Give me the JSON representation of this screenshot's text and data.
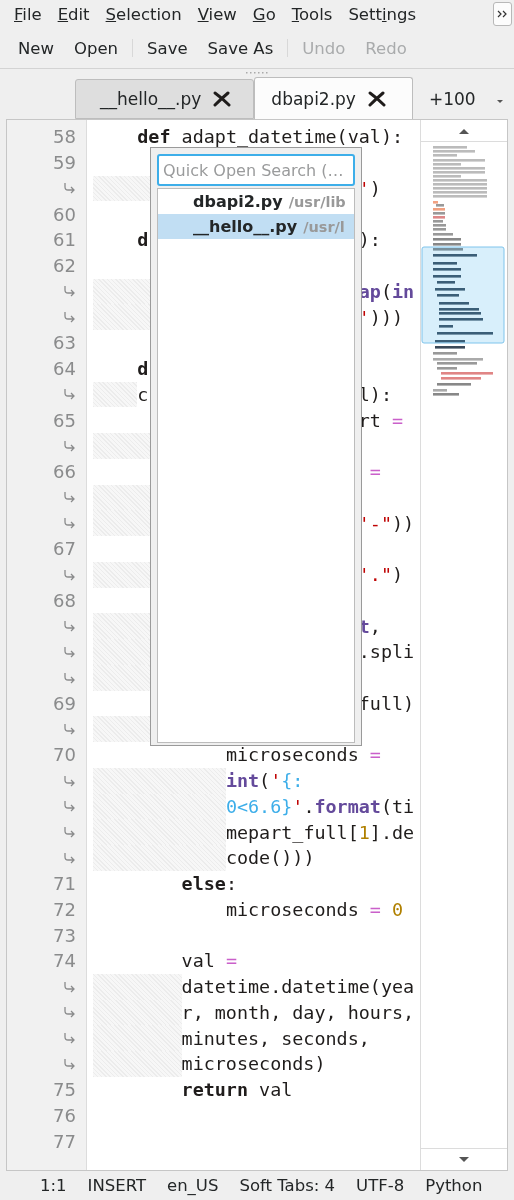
{
  "menu": [
    {
      "key": "F",
      "rest": "ile"
    },
    {
      "key": "E",
      "rest": "dit"
    },
    {
      "key": "S",
      "rest": "election"
    },
    {
      "key": "V",
      "rest": "iew"
    },
    {
      "key": "G",
      "rest": "o"
    },
    {
      "key": "T",
      "rest": "ools"
    },
    {
      "lead": "Sett",
      "key": "i",
      "rest": "ngs"
    }
  ],
  "toolbar": [
    [
      {
        "label": "New",
        "disabled": false
      },
      {
        "label": "Open",
        "disabled": false
      }
    ],
    [
      {
        "label": "Save",
        "disabled": false
      },
      {
        "label": "Save As",
        "disabled": false
      }
    ],
    [
      {
        "label": "Undo",
        "disabled": true
      },
      {
        "label": "Redo",
        "disabled": true
      }
    ]
  ],
  "tabs": [
    {
      "label": "__hello__.py",
      "selected": false
    },
    {
      "label": "dbapi2.py",
      "selected": true
    }
  ],
  "more_tabs": "+100",
  "rows": [
    {
      "number": "58",
      "wrap": false,
      "fragments": [
        [
          {
            "text": "    def",
            "kind": "keyword"
          },
          {
            "text": " adapt_datetime(val):",
            "kind": "plain"
          }
        ]
      ]
    },
    {
      "number": "59",
      "wrap": false
    },
    {
      "wrap": true,
      "fragments": [
        [
          {
            "text": "                        '",
            "kind": "string"
          },
          {
            "text": ")",
            "kind": "plain"
          }
        ]
      ]
    },
    {
      "number": "60",
      "wrap": false
    },
    {
      "number": "61",
      "wrap": false,
      "fragments": [
        [
          {
            "text": "    d",
            "kind": "keyword"
          }
        ],
        [
          {
            "text": "                   ):",
            "kind": "plain"
          }
        ]
      ]
    },
    {
      "number": "62",
      "wrap": false
    },
    {
      "wrap": true,
      "fragments": [
        [
          {
            "text": "                        ap",
            "kind": "builtin"
          },
          {
            "text": "(",
            "kind": "plain"
          },
          {
            "text": "in",
            "kind": "builtin"
          }
        ]
      ]
    },
    {
      "wrap": true,
      "fragments": [
        [
          {
            "text": "                        '",
            "kind": "string"
          },
          {
            "text": ")))",
            "kind": "plain"
          }
        ]
      ]
    },
    {
      "number": "63",
      "wrap": false
    },
    {
      "number": "64",
      "wrap": false,
      "fragments": [
        [
          {
            "text": "    d",
            "kind": "keyword"
          }
        ]
      ]
    },
    {
      "wrap": true,
      "fragments": [
        [
          {
            "text": "    c",
            "kind": "plain"
          }
        ],
        [
          {
            "text": "                   l):",
            "kind": "plain"
          }
        ]
      ]
    },
    {
      "number": "65",
      "wrap": false,
      "fragments": [
        [
          {
            "text": "                        rt ",
            "kind": "plain"
          },
          {
            "text": "=",
            "kind": "operator"
          }
        ]
      ]
    },
    {
      "wrap": true
    },
    {
      "number": "66",
      "wrap": false,
      "fragments": [
        [
          {
            "text": "                         =",
            "kind": "operator"
          }
        ]
      ]
    },
    {
      "wrap": true
    },
    {
      "wrap": true,
      "fragments": [
        [
          {
            "text": "                        '-\"",
            "kind": "string"
          },
          {
            "text": "))",
            "kind": "plain"
          }
        ]
      ]
    },
    {
      "number": "67",
      "wrap": false
    },
    {
      "wrap": true,
      "fragments": [
        [
          {
            "text": "                        '.\"",
            "kind": "string"
          },
          {
            "text": ")",
            "kind": "plain"
          }
        ]
      ]
    },
    {
      "number": "68",
      "wrap": false
    },
    {
      "wrap": true,
      "fragments": [
        [
          {
            "text": "                        t",
            "kind": "builtin"
          },
          {
            "text": ",",
            "kind": "plain"
          }
        ]
      ]
    },
    {
      "wrap": true,
      "fragments": [
        [
          {
            "text": "                        .spli",
            "kind": "plain"
          }
        ]
      ]
    },
    {
      "wrap": true
    },
    {
      "number": "69",
      "wrap": false,
      "fragments": [
        [
          {
            "text": "                        full)",
            "kind": "plain"
          }
        ]
      ]
    },
    {
      "wrap": true
    },
    {
      "number": "70",
      "wrap": false,
      "fragments": [
        [
          {
            "text": "            microseconds ",
            "kind": "plain"
          },
          {
            "text": "=",
            "kind": "operator"
          }
        ]
      ]
    },
    {
      "wrap": true,
      "fragments": [
        [
          {
            "text": "            int",
            "kind": "builtin"
          },
          {
            "text": "(",
            "kind": "plain"
          },
          {
            "text": "'",
            "kind": "string"
          },
          {
            "text": "{:",
            "kind": "format"
          }
        ]
      ]
    },
    {
      "wrap": true,
      "fragments": [
        [
          {
            "text": "            0<6.6}",
            "kind": "format"
          },
          {
            "text": "'",
            "kind": "string"
          },
          {
            "text": ".",
            "kind": "plain"
          },
          {
            "text": "format",
            "kind": "builtin"
          },
          {
            "text": "(ti",
            "kind": "plain"
          }
        ]
      ]
    },
    {
      "wrap": true,
      "fragments": [
        [
          {
            "text": "            mepart_full[",
            "kind": "plain"
          },
          {
            "text": "1",
            "kind": "number"
          },
          {
            "text": "].de",
            "kind": "plain"
          }
        ]
      ]
    },
    {
      "wrap": true,
      "fragments": [
        [
          {
            "text": "            code()))",
            "kind": "plain"
          }
        ]
      ]
    },
    {
      "number": "71",
      "wrap": false,
      "fragments": [
        [
          {
            "text": "        else",
            "kind": "keyword"
          },
          {
            "text": ":",
            "kind": "plain"
          }
        ]
      ]
    },
    {
      "number": "72",
      "wrap": false,
      "fragments": [
        [
          {
            "text": "            microseconds ",
            "kind": "plain"
          },
          {
            "text": "=",
            "kind": "operator"
          },
          {
            "text": " 0",
            "kind": "number"
          }
        ]
      ]
    },
    {
      "number": "73",
      "wrap": false
    },
    {
      "number": "74",
      "wrap": false,
      "fragments": [
        [
          {
            "text": "        val ",
            "kind": "plain"
          },
          {
            "text": "=",
            "kind": "operator"
          }
        ]
      ]
    },
    {
      "wrap": true,
      "fragments": [
        [
          {
            "text": "        datetime.datetime(yea",
            "kind": "plain"
          }
        ]
      ]
    },
    {
      "wrap": true,
      "fragments": [
        [
          {
            "text": "        r, month, day, hours,",
            "kind": "plain"
          }
        ]
      ]
    },
    {
      "wrap": true,
      "fragments": [
        [
          {
            "text": "        minutes, seconds,",
            "kind": "plain"
          }
        ]
      ]
    },
    {
      "wrap": true,
      "fragments": [
        [
          {
            "text": "        microseconds)",
            "kind": "plain"
          }
        ]
      ]
    },
    {
      "number": "75",
      "wrap": false,
      "fragments": [
        [
          {
            "text": "        return",
            "kind": "keyword"
          },
          {
            "text": " val",
            "kind": "plain"
          }
        ]
      ]
    },
    {
      "number": "76",
      "wrap": false
    },
    {
      "number": "77",
      "wrap": false
    }
  ],
  "quick_open": {
    "placeholder": "Quick Open Search (…",
    "results": [
      {
        "name": "dbapi2.py",
        "path": "/usr/lib",
        "selected": false
      },
      {
        "name": "__hello__.py",
        "path": "/usr/l",
        "selected": true
      }
    ]
  },
  "status_bar": [
    "1:1",
    "INSERT",
    "en_US",
    "Soft Tabs: 4",
    "UTF-8",
    "Python"
  ]
}
